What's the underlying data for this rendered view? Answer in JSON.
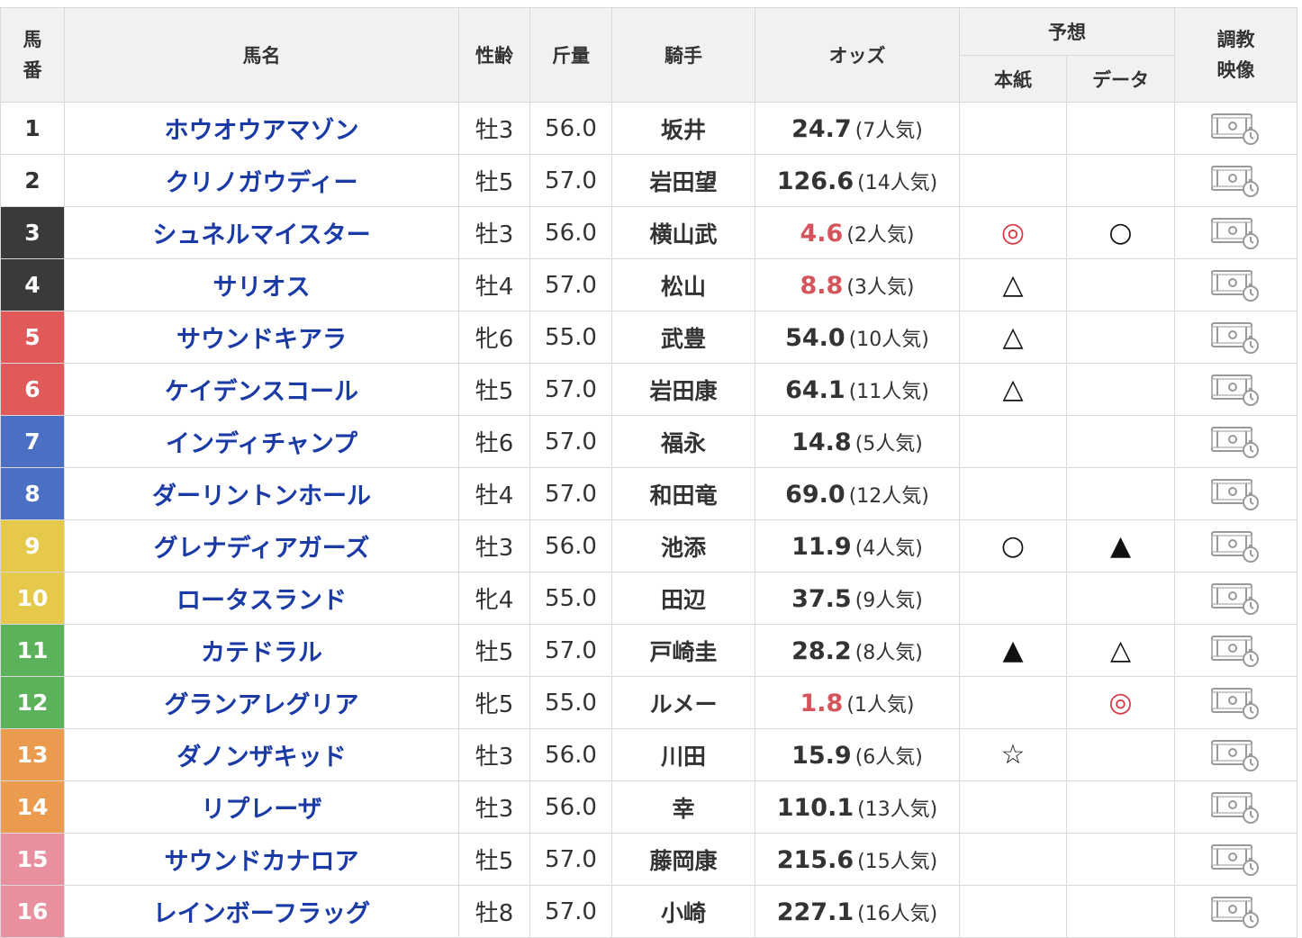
{
  "headers": {
    "umaban": "馬番",
    "horse_name": "馬名",
    "sex_age": "性齢",
    "weight": "斤量",
    "jockey": "騎手",
    "odds": "オッズ",
    "prediction": "予想",
    "paper": "本紙",
    "data": "データ",
    "training_video": "調教映像"
  },
  "waku_colors": {
    "1": {
      "bg": "#ffffff",
      "fg": "#333333"
    },
    "2": {
      "bg": "#3a3a3a",
      "fg": "#ffffff"
    },
    "3": {
      "bg": "#e05a5a",
      "fg": "#ffffff"
    },
    "4": {
      "bg": "#4a6fc3",
      "fg": "#ffffff"
    },
    "5": {
      "bg": "#e6c84a",
      "fg": "#ffffff"
    },
    "6": {
      "bg": "#5bb25a",
      "fg": "#ffffff"
    },
    "7": {
      "bg": "#eb9b4e",
      "fg": "#ffffff"
    },
    "8": {
      "bg": "#e8909e",
      "fg": "#ffffff"
    }
  },
  "video_icon": "training-video-icon",
  "rows": [
    {
      "num": "1",
      "waku": 1,
      "name": "ホウオウアマゾン",
      "sexage": "牡3",
      "weight": "56.0",
      "jockey": "坂井",
      "odds": "24.7",
      "pop": "(7人気)",
      "fav": false,
      "paper": "",
      "paper_red": false,
      "data": "",
      "data_red": false
    },
    {
      "num": "2",
      "waku": 1,
      "name": "クリノガウディー",
      "sexage": "牡5",
      "weight": "57.0",
      "jockey": "岩田望",
      "odds": "126.6",
      "pop": "(14人気)",
      "fav": false,
      "paper": "",
      "paper_red": false,
      "data": "",
      "data_red": false
    },
    {
      "num": "3",
      "waku": 2,
      "name": "シュネルマイスター",
      "sexage": "牡3",
      "weight": "56.0",
      "jockey": "横山武",
      "odds": "4.6",
      "pop": "(2人気)",
      "fav": true,
      "paper": "◎",
      "paper_red": true,
      "data": "○",
      "data_red": false
    },
    {
      "num": "4",
      "waku": 2,
      "name": "サリオス",
      "sexage": "牡4",
      "weight": "57.0",
      "jockey": "松山",
      "odds": "8.8",
      "pop": "(3人気)",
      "fav": true,
      "paper": "△",
      "paper_red": false,
      "data": "",
      "data_red": false
    },
    {
      "num": "5",
      "waku": 3,
      "name": "サウンドキアラ",
      "sexage": "牝6",
      "weight": "55.0",
      "jockey": "武豊",
      "odds": "54.0",
      "pop": "(10人気)",
      "fav": false,
      "paper": "△",
      "paper_red": false,
      "data": "",
      "data_red": false
    },
    {
      "num": "6",
      "waku": 3,
      "name": "ケイデンスコール",
      "sexage": "牡5",
      "weight": "57.0",
      "jockey": "岩田康",
      "odds": "64.1",
      "pop": "(11人気)",
      "fav": false,
      "paper": "△",
      "paper_red": false,
      "data": "",
      "data_red": false
    },
    {
      "num": "7",
      "waku": 4,
      "name": "インディチャンプ",
      "sexage": "牡6",
      "weight": "57.0",
      "jockey": "福永",
      "odds": "14.8",
      "pop": "(5人気)",
      "fav": false,
      "paper": "",
      "paper_red": false,
      "data": "",
      "data_red": false
    },
    {
      "num": "8",
      "waku": 4,
      "name": "ダーリントンホール",
      "sexage": "牡4",
      "weight": "57.0",
      "jockey": "和田竜",
      "odds": "69.0",
      "pop": "(12人気)",
      "fav": false,
      "paper": "",
      "paper_red": false,
      "data": "",
      "data_red": false
    },
    {
      "num": "9",
      "waku": 5,
      "name": "グレナディアガーズ",
      "sexage": "牡3",
      "weight": "56.0",
      "jockey": "池添",
      "odds": "11.9",
      "pop": "(4人気)",
      "fav": false,
      "paper": "○",
      "paper_red": false,
      "data": "▲",
      "data_red": false
    },
    {
      "num": "10",
      "waku": 5,
      "name": "ロータスランド",
      "sexage": "牝4",
      "weight": "55.0",
      "jockey": "田辺",
      "odds": "37.5",
      "pop": "(9人気)",
      "fav": false,
      "paper": "",
      "paper_red": false,
      "data": "",
      "data_red": false
    },
    {
      "num": "11",
      "waku": 6,
      "name": "カテドラル",
      "sexage": "牡5",
      "weight": "57.0",
      "jockey": "戸崎圭",
      "odds": "28.2",
      "pop": "(8人気)",
      "fav": false,
      "paper": "▲",
      "paper_red": false,
      "data": "△",
      "data_red": false
    },
    {
      "num": "12",
      "waku": 6,
      "name": "グランアレグリア",
      "sexage": "牝5",
      "weight": "55.0",
      "jockey": "ルメー",
      "odds": "1.8",
      "pop": "(1人気)",
      "fav": true,
      "paper": "",
      "paper_red": false,
      "data": "◎",
      "data_red": true
    },
    {
      "num": "13",
      "waku": 7,
      "name": "ダノンザキッド",
      "sexage": "牡3",
      "weight": "56.0",
      "jockey": "川田",
      "odds": "15.9",
      "pop": "(6人気)",
      "fav": false,
      "paper": "☆",
      "paper_red": false,
      "data": "",
      "data_red": false
    },
    {
      "num": "14",
      "waku": 7,
      "name": "リプレーザ",
      "sexage": "牡3",
      "weight": "56.0",
      "jockey": "幸",
      "odds": "110.1",
      "pop": "(13人気)",
      "fav": false,
      "paper": "",
      "paper_red": false,
      "data": "",
      "data_red": false
    },
    {
      "num": "15",
      "waku": 8,
      "name": "サウンドカナロア",
      "sexage": "牡5",
      "weight": "57.0",
      "jockey": "藤岡康",
      "odds": "215.6",
      "pop": "(15人気)",
      "fav": false,
      "paper": "",
      "paper_red": false,
      "data": "",
      "data_red": false
    },
    {
      "num": "16",
      "waku": 8,
      "name": "レインボーフラッグ",
      "sexage": "牡8",
      "weight": "57.0",
      "jockey": "小崎",
      "odds": "227.1",
      "pop": "(16人気)",
      "fav": false,
      "paper": "",
      "paper_red": false,
      "data": "",
      "data_red": false
    }
  ]
}
